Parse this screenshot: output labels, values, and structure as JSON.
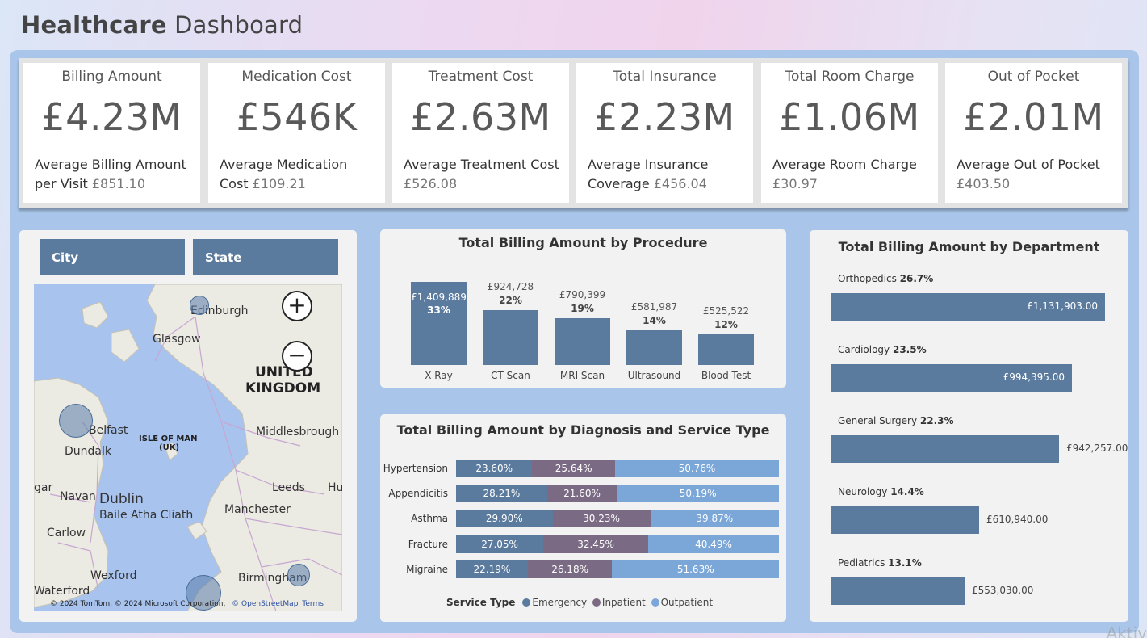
{
  "header": {
    "title_bold": "Healthcare",
    "title_rest": "Dashboard"
  },
  "kpis": [
    {
      "label": "Billing Amount",
      "value": "£4.23M",
      "sub_text": "Average Billing Amount per Visit",
      "sub_value": "£851.10"
    },
    {
      "label": "Medication Cost",
      "value": "£546K",
      "sub_text": "Average Medication Cost",
      "sub_value": "£109.21"
    },
    {
      "label": "Treatment Cost",
      "value": "£2.63M",
      "sub_text": "Average Treatment Cost",
      "sub_value": "£526.08"
    },
    {
      "label": "Total Insurance",
      "value": "£2.23M",
      "sub_text": "Average Insurance Coverage",
      "sub_value": "£456.04"
    },
    {
      "label": "Total Room Charge",
      "value": "£1.06M",
      "sub_text": "Average Room Charge",
      "sub_value": "£30.97"
    },
    {
      "label": "Out of Pocket",
      "value": "£2.01M",
      "sub_text": "Average Out of Pocket",
      "sub_value": "£403.50"
    }
  ],
  "slicers": {
    "city": "City",
    "state": "State"
  },
  "map": {
    "zoom_in": "+",
    "zoom_out": "−",
    "labels": {
      "edinburgh": "Edinburgh",
      "glasgow": "Glasgow",
      "united": "UNITED",
      "kingdom": "KINGDOM",
      "belfast": "Belfast",
      "isle_of_man": "ISLE OF MAN",
      "uk": "(UK)",
      "dundalk": "Dundalk",
      "middlesbrough": "Middlesbrough",
      "gar": "gar",
      "navan": "Navan",
      "dublin": "Dublin",
      "baile": "Baile Atha Cliath",
      "leeds": "Leeds",
      "hu": "Hu",
      "manchester": "Manchester",
      "carlow": "Carlow",
      "wexford": "Wexford",
      "birmingham": "Birmingham",
      "waterford": "Waterford"
    },
    "attribution": "© 2024 TomTom, © 2024 Microsoft Corporation, ",
    "osm_link": "© OpenStreetMap",
    "terms_link": "Terms"
  },
  "procedure_chart": {
    "title": "Total Billing Amount by Procedure",
    "value_labels": [
      "£1,409,889",
      "£924,728",
      "£790,399",
      "£581,987",
      "£525,522"
    ],
    "pct_labels": [
      "33%",
      "22%",
      "19%",
      "14%",
      "12%"
    ]
  },
  "diagnosis_chart": {
    "title": "Total Billing Amount by Diagnosis and Service Type",
    "legend_title": "Service Type",
    "segment_labels": [
      [
        "23.60%",
        "25.64%",
        "50.76%"
      ],
      [
        "28.21%",
        "21.60%",
        "50.19%"
      ],
      [
        "29.90%",
        "30.23%",
        "39.87%"
      ],
      [
        "27.05%",
        "32.45%",
        "40.49%"
      ],
      [
        "22.19%",
        "26.18%",
        "51.63%"
      ]
    ]
  },
  "department_chart": {
    "title": "Total Billing Amount by Department",
    "pct_labels": [
      "26.7%",
      "23.5%",
      "22.3%",
      "14.4%",
      "13.1%"
    ],
    "value_labels": [
      "£1,131,903.00",
      "£994,395.00",
      "£942,257.00",
      "£610,940.00",
      "£553,030.00"
    ]
  },
  "chart_data": [
    {
      "type": "bar",
      "title": "Total Billing Amount by Procedure",
      "categories": [
        "X-Ray",
        "CT Scan",
        "MRI Scan",
        "Ultrasound",
        "Blood Test"
      ],
      "values": [
        1409889,
        924728,
        790399,
        581987,
        525522
      ],
      "percent": [
        33,
        22,
        19,
        14,
        12
      ],
      "color": "#5b7b9e"
    },
    {
      "type": "bar",
      "stacked": "100%",
      "orientation": "horizontal",
      "title": "Total Billing Amount by Diagnosis and Service Type",
      "categories": [
        "Hypertension",
        "Appendicitis",
        "Asthma",
        "Fracture",
        "Migraine"
      ],
      "series": [
        {
          "name": "Emergency",
          "color": "#5b7b9e",
          "values": [
            23.6,
            28.21,
            29.9,
            27.05,
            22.19
          ]
        },
        {
          "name": "Inpatient",
          "color": "#7a6a83",
          "values": [
            25.64,
            21.6,
            30.23,
            32.45,
            26.18
          ]
        },
        {
          "name": "Outpatient",
          "color": "#7aa6d8",
          "values": [
            50.76,
            50.19,
            39.87,
            40.49,
            51.63
          ]
        }
      ],
      "legend": "bottom"
    },
    {
      "type": "bar",
      "orientation": "horizontal",
      "title": "Total Billing Amount by Department",
      "categories": [
        "Orthopedics",
        "Cardiology",
        "General Surgery",
        "Neurology",
        "Pediatrics"
      ],
      "values": [
        1131903.0,
        994395.0,
        942257.0,
        610940.0,
        553030.0
      ],
      "percent": [
        26.7,
        23.5,
        22.3,
        14.4,
        13.1
      ],
      "color": "#5b7b9e"
    }
  ],
  "watermark": "Aktiv"
}
